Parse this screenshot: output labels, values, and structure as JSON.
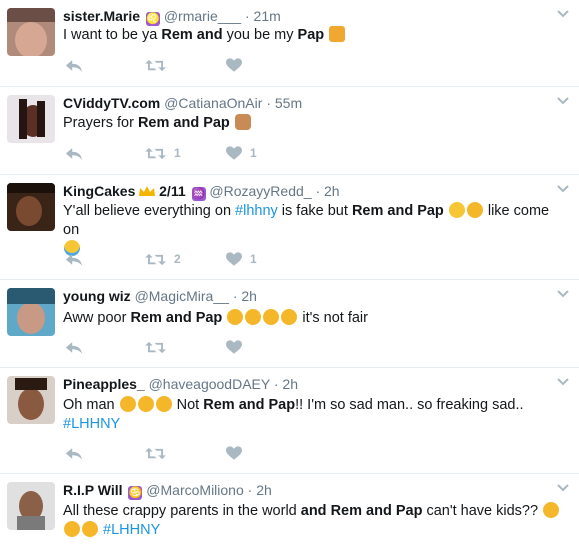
{
  "tweets": [
    {
      "name": "sister.Marie",
      "badge": "♌",
      "handle": "@rmarie___",
      "time": "21m",
      "text_parts": [
        "I want to be ya ",
        "Rem and",
        " you be my ",
        "Pap",
        " "
      ],
      "retweets": "",
      "likes": ""
    },
    {
      "name": "CViddyTV.com",
      "handle": "@CatianaOnAir",
      "time": "55m",
      "text_parts": [
        "Prayers for ",
        "Rem and Pap",
        " "
      ],
      "retweets": "1",
      "likes": "1"
    },
    {
      "name": "KingCakes",
      "name_suffix": "2/11",
      "badge": "♒",
      "handle": "@RozayyRedd_",
      "time": "2h",
      "text_parts": [
        "Y'all believe everything on ",
        "#lhhny",
        " is fake but ",
        "Rem and Pap",
        " ",
        " like come on"
      ],
      "retweets": "2",
      "likes": "1"
    },
    {
      "name": "young wiz",
      "handle": "@MagicMira__",
      "time": "2h",
      "text_parts": [
        "Aww poor ",
        "Rem and Pap",
        " ",
        " it's not fair"
      ],
      "retweets": "",
      "likes": ""
    },
    {
      "name": "Pineapples_",
      "handle": "@haveagoodDAEY",
      "time": "2h",
      "text_parts": [
        "Oh man ",
        " Not ",
        "Rem and Pap",
        "!! I'm so sad man.. so freaking sad..",
        "#LHHNY"
      ],
      "retweets": "",
      "likes": ""
    },
    {
      "name": "R.I.P Will",
      "badge": "♋",
      "handle": "@MarcoMiliono",
      "time": "2h",
      "text_parts": [
        "All these crappy parents in the world ",
        "and Rem and Pap",
        " can't have kids?? ",
        "#LHHNY"
      ],
      "retweets": "",
      "likes": ""
    }
  ],
  "dot": "·",
  "icons": {
    "reply": "reply-icon",
    "retweet": "retweet-icon",
    "like": "heart-icon",
    "more": "chevron-down-icon"
  },
  "colors": {
    "hashtag": "#1b95e0",
    "muted": "#657786",
    "action": "#aab8c2"
  }
}
